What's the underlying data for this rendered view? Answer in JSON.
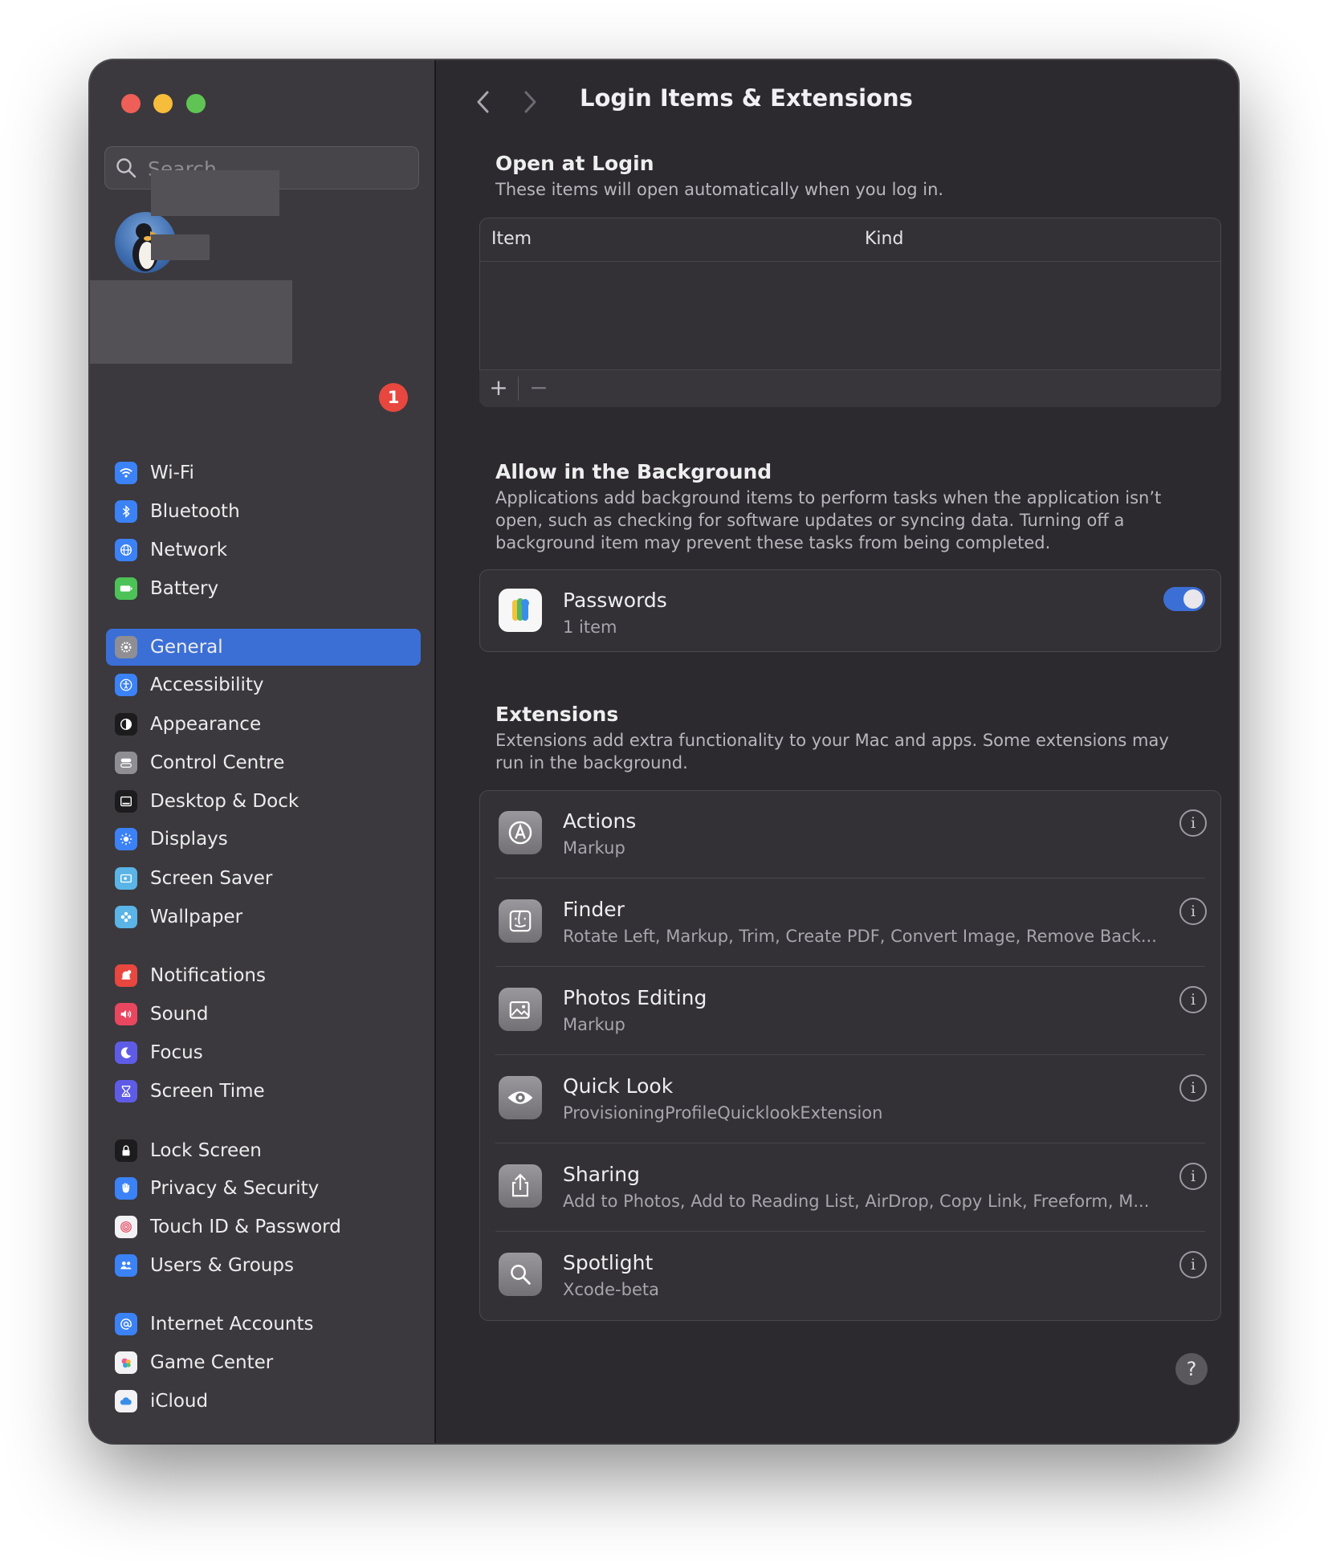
{
  "sidebar": {
    "search_placeholder": "Search",
    "badge_count": "1",
    "groups": [
      [
        {
          "label": "Wi-Fi",
          "icon": "wifi-icon",
          "color": "#3b82f6"
        },
        {
          "label": "Bluetooth",
          "icon": "bluetooth-icon",
          "color": "#3b82f6"
        },
        {
          "label": "Network",
          "icon": "globe-icon",
          "color": "#3b82f6"
        },
        {
          "label": "Battery",
          "icon": "battery-icon",
          "color": "#4cc257"
        }
      ],
      [
        {
          "label": "General",
          "icon": "gear-icon",
          "color": "#8e8e93",
          "selected": true
        },
        {
          "label": "Accessibility",
          "icon": "accessibility-icon",
          "color": "#3b82f6"
        },
        {
          "label": "Appearance",
          "icon": "appearance-icon",
          "color": "#1c1c1e"
        },
        {
          "label": "Control Centre",
          "icon": "control-centre-icon",
          "color": "#8e8e93"
        },
        {
          "label": "Desktop & Dock",
          "icon": "dock-icon",
          "color": "#1c1c1e"
        },
        {
          "label": "Displays",
          "icon": "sun-icon",
          "color": "#3b82f6"
        },
        {
          "label": "Screen Saver",
          "icon": "screen-saver-icon",
          "color": "#5ab4e6"
        },
        {
          "label": "Wallpaper",
          "icon": "flower-icon",
          "color": "#5ab4e6"
        }
      ],
      [
        {
          "label": "Notifications",
          "icon": "bell-icon",
          "color": "#e8473f"
        },
        {
          "label": "Sound",
          "icon": "speaker-icon",
          "color": "#e8475f"
        },
        {
          "label": "Focus",
          "icon": "moon-icon",
          "color": "#5e5ce6"
        },
        {
          "label": "Screen Time",
          "icon": "hourglass-icon",
          "color": "#5e5ce6"
        }
      ],
      [
        {
          "label": "Lock Screen",
          "icon": "lock-icon",
          "color": "#1c1c1e"
        },
        {
          "label": "Privacy & Security",
          "icon": "hand-icon",
          "color": "#3b82f6"
        },
        {
          "label": "Touch ID & Password",
          "icon": "fingerprint-icon",
          "color": "#f2f2f5"
        },
        {
          "label": "Users & Groups",
          "icon": "users-icon",
          "color": "#3b82f6"
        }
      ],
      [
        {
          "label": "Internet Accounts",
          "icon": "at-icon",
          "color": "#3b82f6"
        },
        {
          "label": "Game Center",
          "icon": "game-center-icon",
          "color": "#f2f2f5"
        },
        {
          "label": "iCloud",
          "icon": "cloud-icon",
          "color": "#f2f2f5"
        }
      ]
    ]
  },
  "main": {
    "title": "Login Items & Extensions",
    "open_at_login": {
      "title": "Open at Login",
      "description": "These items will open automatically when you log in.",
      "columns": [
        "Item",
        "Kind"
      ],
      "add_label": "+",
      "remove_label": "−"
    },
    "background": {
      "title": "Allow in the Background",
      "description": "Applications add background items to perform tasks when the application isn’t open, such as checking for software updates or syncing data. Turning off a background item may prevent these tasks from being completed.",
      "items": [
        {
          "name": "Passwords",
          "detail": "1 item",
          "enabled": true,
          "icon": "passwords-icon"
        }
      ]
    },
    "extensions": {
      "title": "Extensions",
      "description": "Extensions add extra functionality to your Mac and apps. Some extensions may run in the background.",
      "items": [
        {
          "name": "Actions",
          "detail": "Markup",
          "icon": "actions-icon"
        },
        {
          "name": "Finder",
          "detail": "Rotate Left, Markup, Trim, Create PDF, Convert Image, Remove Back...",
          "icon": "finder-icon"
        },
        {
          "name": "Photos Editing",
          "detail": "Markup",
          "icon": "photos-editing-icon"
        },
        {
          "name": "Quick Look",
          "detail": "ProvisioningProfileQuicklookExtension",
          "icon": "eye-icon"
        },
        {
          "name": "Sharing",
          "detail": "Add to Photos, Add to Reading List, AirDrop, Copy Link, Freeform, M...",
          "icon": "share-icon"
        },
        {
          "name": "Spotlight",
          "detail": "Xcode-beta",
          "icon": "magnifier-icon"
        }
      ]
    },
    "info_glyph": "i",
    "help_glyph": "?"
  }
}
